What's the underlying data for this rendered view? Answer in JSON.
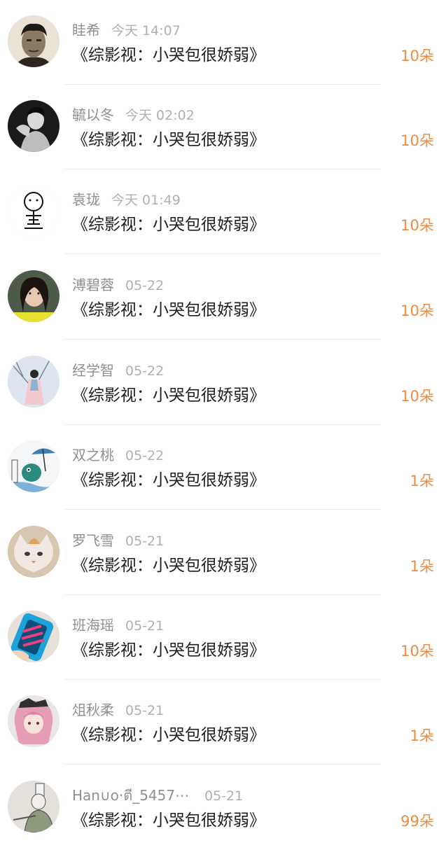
{
  "items": [
    {
      "name": "眭希",
      "time": "今天 14:07",
      "title": "《综影视：小哭包很娇弱》",
      "amount": "10朵",
      "avatar": "man-portrait-avatar"
    },
    {
      "name": "毓以冬",
      "time": "今天 02:02",
      "title": "《综影视：小哭包很娇弱》",
      "amount": "10朵",
      "avatar": "bw-man-avatar"
    },
    {
      "name": "袁珑",
      "time": "今天 01:49",
      "title": "《综影视：小哭包很娇弱》",
      "amount": "10朵",
      "avatar": "doodle-avatar"
    },
    {
      "name": "溥碧蓉",
      "time": "05-22",
      "title": "《综影视：小哭包很娇弱》",
      "amount": "10朵",
      "avatar": "girl-selfie-avatar"
    },
    {
      "name": "经学智",
      "time": "05-22",
      "title": "《综影视：小哭包很娇弱》",
      "amount": "10朵",
      "avatar": "winter-girl-avatar"
    },
    {
      "name": "双之桃",
      "time": "05-22",
      "title": "《综影视：小哭包很娇弱》",
      "amount": "1朵",
      "avatar": "umbrella-cartoon-avatar"
    },
    {
      "name": "罗飞雪",
      "time": "05-21",
      "title": "《综影视：小哭包很娇弱》",
      "amount": "1朵",
      "avatar": "cat-avatar"
    },
    {
      "name": "班海瑶",
      "time": "05-21",
      "title": "《综影视：小哭包很娇弱》",
      "amount": "10朵",
      "avatar": "shoe-avatar"
    },
    {
      "name": "俎秋柔",
      "time": "05-21",
      "title": "《综影视：小哭包很娇弱》",
      "amount": "1朵",
      "avatar": "anime-girl-avatar"
    },
    {
      "name": "Han∪o·ตี_5457⋯",
      "time": "05-21",
      "title": "《综影视：小哭包很娇弱》",
      "amount": "99朵",
      "avatar": "sketch-avatar"
    }
  ]
}
